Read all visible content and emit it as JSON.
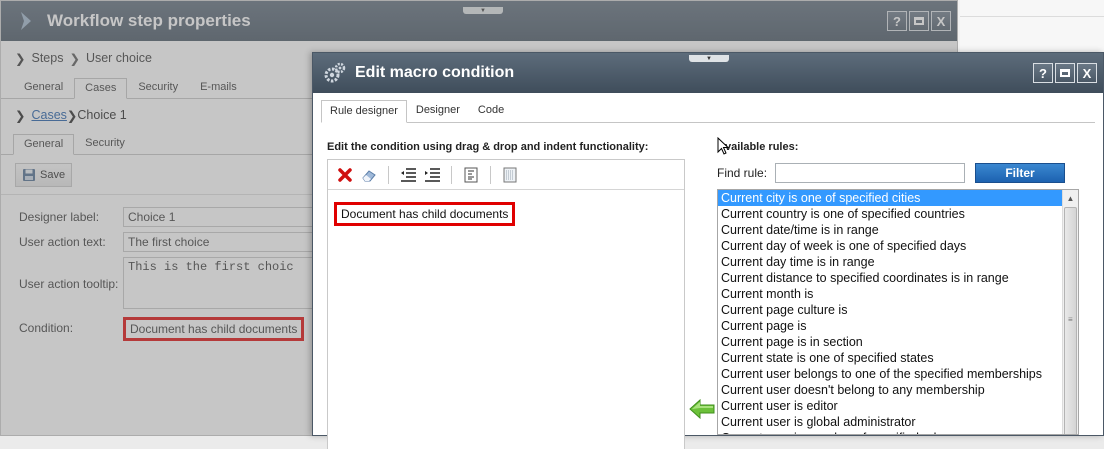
{
  "background_dialog": {
    "title": "Workflow step properties",
    "breadcrumb": {
      "root": "Steps",
      "current": "User choice"
    },
    "tabs": [
      "General",
      "Cases",
      "Security",
      "E-mails"
    ],
    "active_tab": "Cases",
    "breadcrumb2": {
      "root": "Cases",
      "current": "Choice 1"
    },
    "sub_tabs": [
      "General",
      "Security"
    ],
    "save_label": "Save",
    "form": {
      "designer_label": {
        "label": "Designer label:",
        "value": "Choice 1"
      },
      "user_action_text": {
        "label": "User action text:",
        "value": "The first choice"
      },
      "user_action_tooltip": {
        "label": "User action tooltip:",
        "value": "This is the first choic"
      },
      "condition": {
        "label": "Condition:",
        "value": "Document has child documents"
      }
    },
    "window_buttons": [
      "?",
      "",
      "X"
    ]
  },
  "dialog": {
    "title": "Edit macro condition",
    "window_buttons": [
      "?",
      "",
      "X"
    ],
    "tabs": [
      "Rule designer",
      "Designer",
      "Code"
    ],
    "active_tab": "Rule designer",
    "designer": {
      "heading": "Edit the condition using drag & drop and indent functionality:",
      "rule": "Document has child documents"
    },
    "rules": {
      "heading": "vailable rules:",
      "find_label": "Find rule:",
      "find_value": "",
      "filter_label": "Filter",
      "items": [
        "Current city is one of specified cities",
        "Current country is one of specified countries",
        "Current date/time is in range",
        "Current day of week is one of specified days",
        "Current day time is in range",
        "Current distance to specified coordinates is in range",
        "Current month is",
        "Current page culture is",
        "Current page is",
        "Current page is in section",
        "Current state is one of specified states",
        "Current user belongs to one of the specified memberships",
        "Current user doesn't belong to any membership",
        "Current user is editor",
        "Current user is global administrator",
        "Current user is member of specified role"
      ],
      "selected_index": 0
    }
  },
  "colors": {
    "titlebar": "#4b5866",
    "highlight_border": "#e00000",
    "selection": "#3399ff",
    "filter_button": "#2a74c2"
  }
}
